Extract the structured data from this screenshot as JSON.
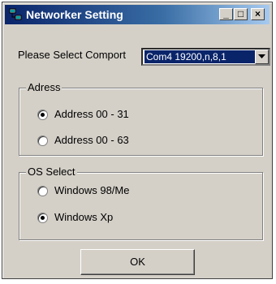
{
  "window": {
    "title": "Networker Setting",
    "min_label": "_",
    "max_label": "□",
    "close_label": "×"
  },
  "comport": {
    "label": "Please Select Comport",
    "selected": "Com4 19200,n,8,1"
  },
  "address_group": {
    "legend": "Adress",
    "options": [
      {
        "label": "Address 00 - 31",
        "checked": true
      },
      {
        "label": "Address 00 - 63",
        "checked": false
      }
    ]
  },
  "os_group": {
    "legend": "OS Select",
    "options": [
      {
        "label": "Windows 98/Me",
        "checked": false
      },
      {
        "label": "Windows Xp",
        "checked": true
      }
    ]
  },
  "ok_label": "OK",
  "colors": {
    "titlebar_start": "#0a246a",
    "titlebar_end": "#a6caf0",
    "face": "#d4d0c8",
    "selection": "#0a246a"
  }
}
